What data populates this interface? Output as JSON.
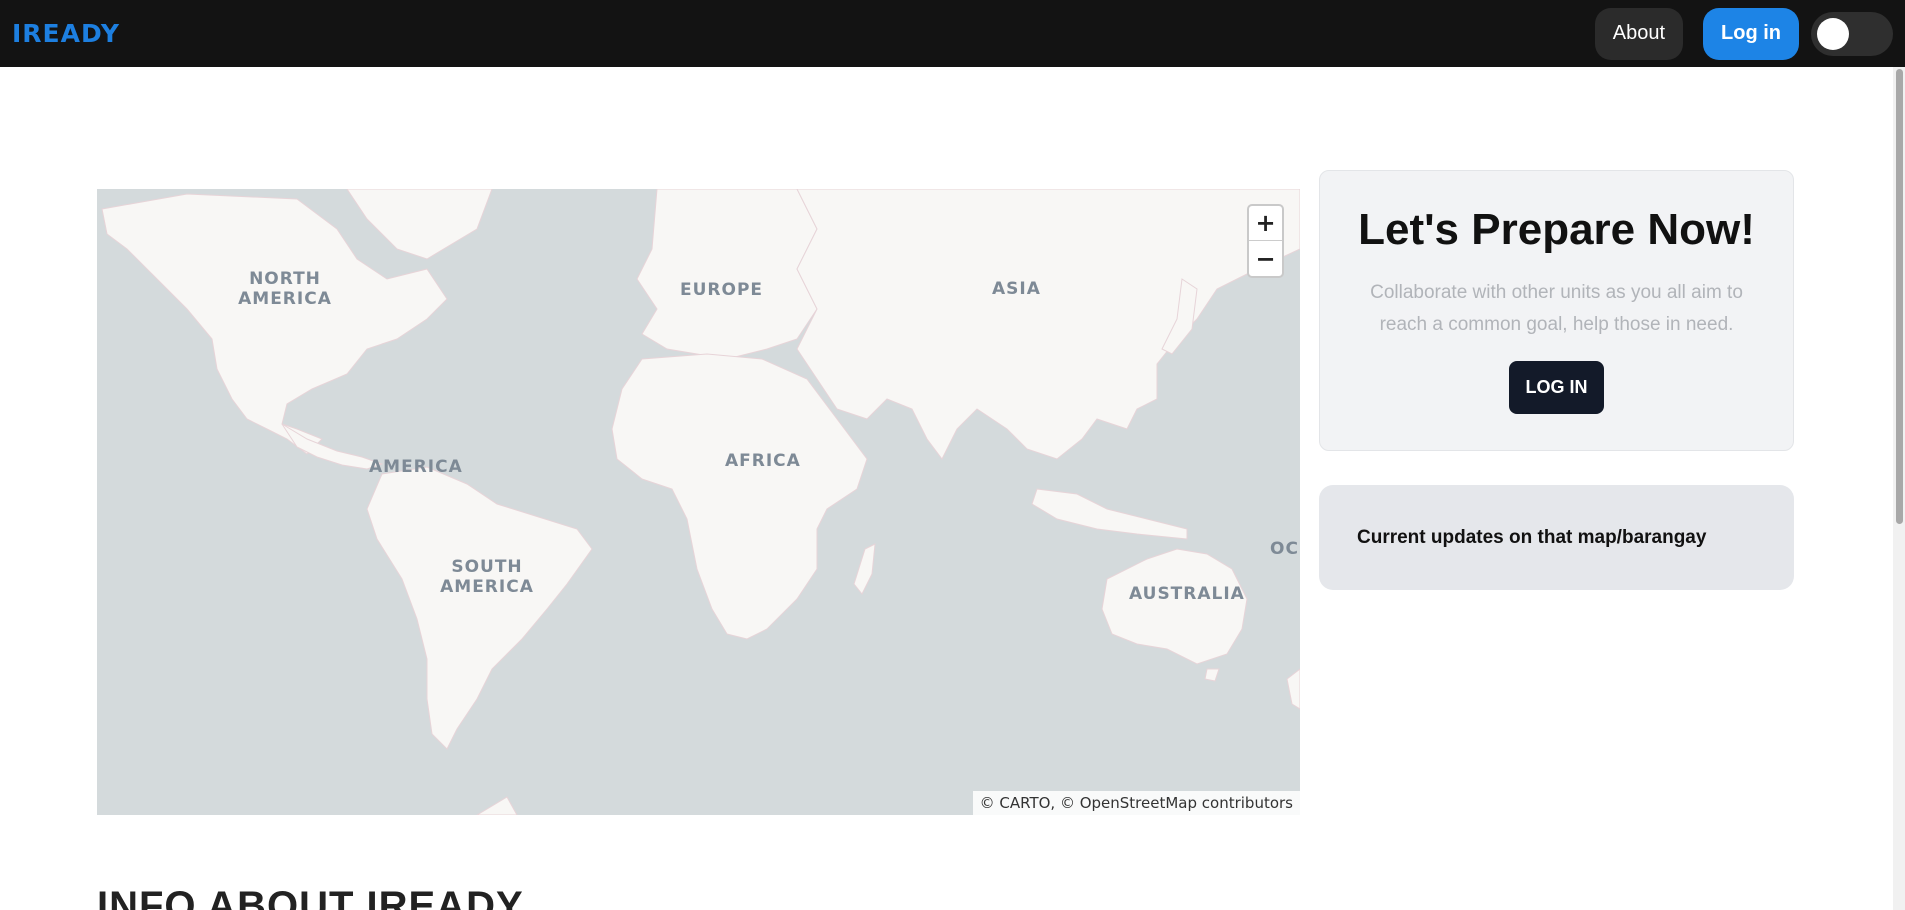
{
  "navbar": {
    "brand": "IREADY",
    "about_label": "About",
    "login_label": "Log in",
    "theme_toggle_icon": "toggle-switch-icon"
  },
  "map": {
    "zoom_in_label": "+",
    "zoom_out_label": "−",
    "attribution": "© CARTO, © OpenStreetMap contributors",
    "labels": {
      "north_america": "NORTH\nAMERICA",
      "europe": "EUROPE",
      "asia": "ASIA",
      "america": "AMERICA",
      "africa": "AFRICA",
      "south_america": "SOUTH\nAMERICA",
      "australia": "AUSTRALIA",
      "oc": "OC"
    },
    "colors": {
      "water": "#d4dadc",
      "land": "#f8f7f5",
      "borders": "#e7c9cf"
    }
  },
  "hero": {
    "title": "Let's Prepare Now!",
    "subtitle": "Collaborate with other units as you all aim to reach a common goal, help those in need.",
    "button_label": "LOG IN"
  },
  "updates": {
    "text": "Current updates on that map/barangay"
  },
  "info_section": {
    "heading": "INFO ABOUT IREADY"
  },
  "colors": {
    "nav_bg": "#131313",
    "brand": "#1d7fe0",
    "accent": "#1d84e6",
    "hero_button": "#131a29"
  }
}
